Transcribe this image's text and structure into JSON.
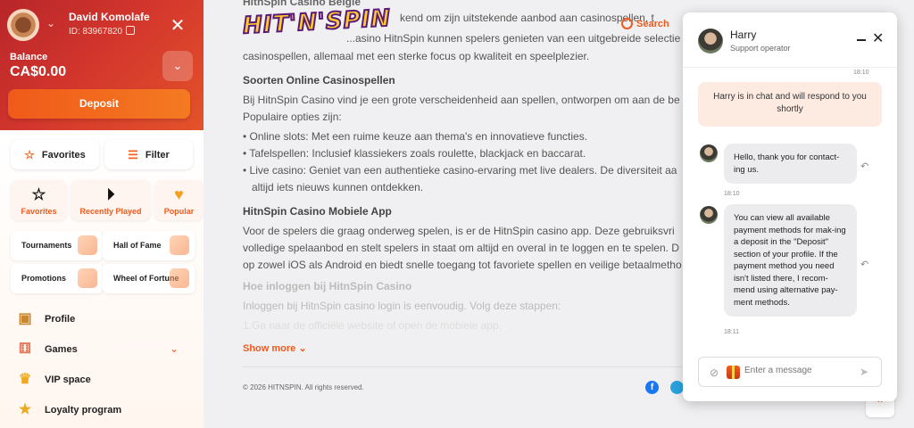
{
  "user": {
    "name": "David Komolafe",
    "id_text": "ID: 83967820"
  },
  "balance": {
    "label": "Balance",
    "value": "CA$0.00"
  },
  "deposit_label": "Deposit",
  "quick": {
    "favorites": "Favorites",
    "filter": "Filter"
  },
  "tiles": [
    {
      "label": "Favorites"
    },
    {
      "label": "Recently Played"
    },
    {
      "label": "Popular"
    }
  ],
  "promos": [
    "Tournaments",
    "Hall of Fame",
    "Promotions",
    "Wheel of Fortune"
  ],
  "menu": [
    "Profile",
    "Games",
    "VIP space",
    "Loyalty program"
  ],
  "header": {
    "logo": "HIT'N'SPIN",
    "search": "Search"
  },
  "article": {
    "intro_line1": "HitnSpin Casino België",
    "intro_line2": "kend om zijn uitstekende aanbod aan casinospellen, t",
    "intro_line3": "...asino HitnSpin kunnen spelers genieten van een uitgebreide selectie",
    "intro_line4": "casinospellen, allemaal met een sterke focus op kwaliteit en speelplezier.",
    "h1": "Soorten Online Casinospellen",
    "p1a": "Bij HitnSpin Casino vind je een grote verscheidenheid aan spellen, ontworpen om aan de be",
    "p1b": "Populaire opties zijn:",
    "b1": "• Online slots: Met een ruime keuze aan thema's en innovatieve functies.",
    "b2": "• Tafelspellen: Inclusief klassiekers zoals roulette, blackjack en baccarat.",
    "b3a": "• Live casino: Geniet van een authentieke casino-ervaring met live dealers. De diversiteit aa",
    "b3b": "altijd iets nieuws kunnen ontdekken.",
    "h2": "HitnSpin Casino Mobiele App",
    "p2a": "Voor de spelers die graag onderweg spelen, is er de HitnSpin casino app. Deze gebruiksvri",
    "p2b": "volledige spelaanbod en stelt spelers in staat om altijd en overal in te loggen en te spelen. D",
    "p2c": "op zowel iOS als Android en biedt snelle toegang tot favoriete spellen en veilige betaalmetho",
    "h3": "Hoe inloggen bij HitnSpin Casino",
    "p3": "Inloggen bij HitnSpin casino login is eenvoudig. Volg deze stappen:",
    "p4": "1.Ga naar de officiële website of open de mobiele app."
  },
  "show_more": "Show more",
  "copyright": "© 2026 HITNSPIN. All rights reserved.",
  "chat": {
    "operator": "Harry",
    "role": "Support operator",
    "t1": "18:10",
    "system": "Harry is in chat and will respond to you shortly",
    "m1": "Hello, thank you for contact-ing us.",
    "t2": "18:10",
    "m2": "You can view all available payment methods for mak-ing a deposit in the \"Deposit\" section of your profile. If the payment method you need isn't listed there, I recom-mend using alternative pay-ment methods.",
    "t3": "18:11",
    "placeholder": "Enter a message"
  }
}
